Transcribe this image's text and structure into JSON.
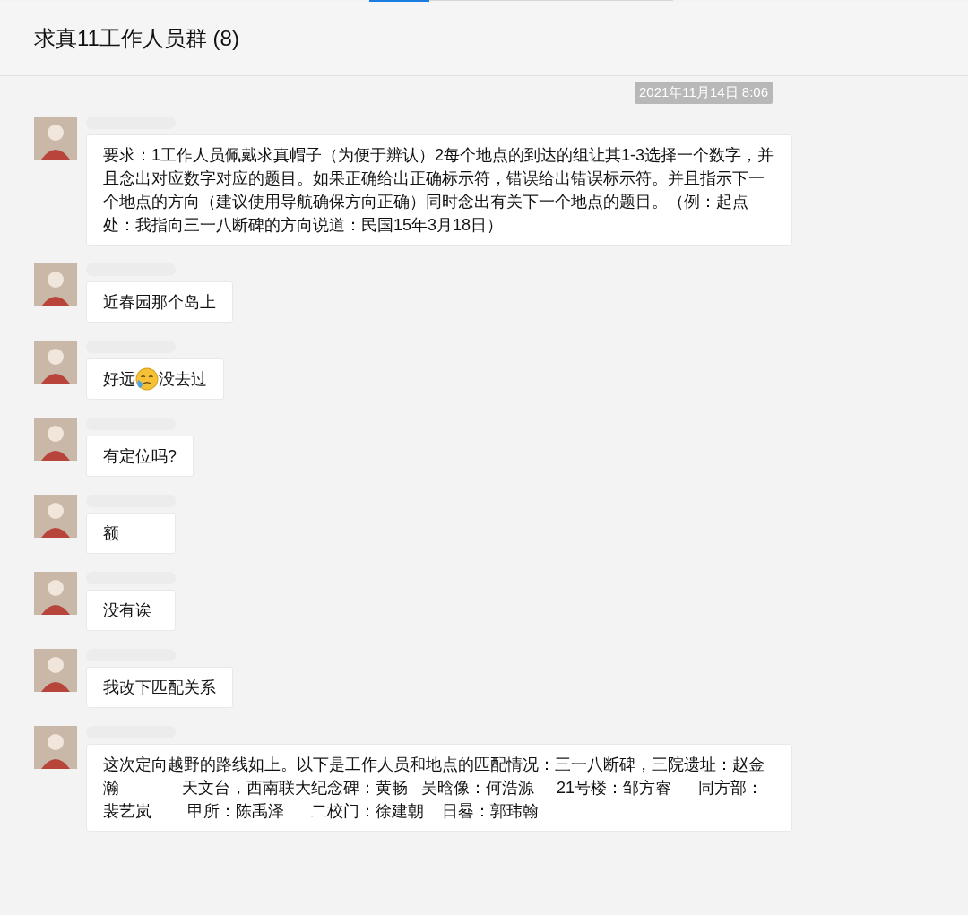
{
  "window": {
    "title": "求真11工作人员群 (8)"
  },
  "timestamp": "2021年11月14日 8:06",
  "messages": [
    {
      "parts": [
        {
          "kind": "text",
          "text": "要求：1工作人员佩戴求真帽子（为便于辨认）2每个地点的到达的组让其1-3选择一个数字，并且念出对应数字对应的题目。如果正确给出正确标示符，错误给出错误标示符。并且指示下一个地点的方向（建议使用导航确保方向正确）同时念出有关下一个地点的题目。（例：起点处：我指向三一八断碑的方向说道：民国15年3月18日）"
        }
      ]
    },
    {
      "parts": [
        {
          "kind": "text",
          "text": "近春园那个岛上"
        }
      ]
    },
    {
      "parts": [
        {
          "kind": "text",
          "text": "好远"
        },
        {
          "kind": "emoji"
        },
        {
          "kind": "text",
          "text": "没去过"
        }
      ]
    },
    {
      "parts": [
        {
          "kind": "text",
          "text": "有定位吗?"
        }
      ]
    },
    {
      "parts": [
        {
          "kind": "text",
          "text": "额"
        }
      ]
    },
    {
      "parts": [
        {
          "kind": "text",
          "text": "没有诶"
        }
      ]
    },
    {
      "parts": [
        {
          "kind": "text",
          "text": "我改下匹配关系"
        }
      ]
    },
    {
      "parts": [
        {
          "kind": "text",
          "text": "这次定向越野的路线如上。以下是工作人员和地点的匹配情况：三一八断碑，三院遗址：赵金瀚              天文台，西南联大纪念碑：黄畅   吴晗像：何浩源     21号楼：邹方睿      同方部：裴艺岚        甲所：陈禹泽      二校门：徐建朝    日晷：郭玮翰"
        }
      ]
    }
  ]
}
